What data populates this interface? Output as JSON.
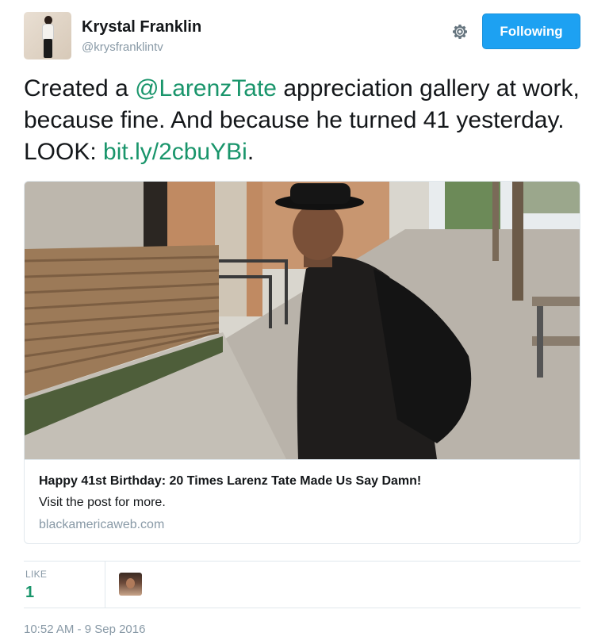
{
  "user": {
    "name": "Krystal Franklin",
    "handle": "@krysfranklintv",
    "avatar_icon": "profile-photo"
  },
  "follow_button": {
    "label": "Following",
    "color": "#1da1f2"
  },
  "settings_icon": "gear-icon",
  "tweet": {
    "segments": [
      {
        "text": "Created a ",
        "link": false
      },
      {
        "text": "@LarenzTate",
        "link": true
      },
      {
        "text": " appreciation gallery at work, because fine. And because he turned 41 yesterday. LOOK: ",
        "link": false
      },
      {
        "text": "bit.ly/2cbuYBi",
        "link": true
      },
      {
        "text": ".",
        "link": false
      }
    ],
    "link_color": "#19956b"
  },
  "card": {
    "title": "Happy 41st Birthday: 20 Times Larenz Tate Made Us Say Damn!",
    "description": "Visit the post for more.",
    "domain": "blackamericaweb.com"
  },
  "stats": {
    "like_label": "LIKE",
    "like_count": "1"
  },
  "timestamp": "10:52 AM - 9 Sep 2016"
}
